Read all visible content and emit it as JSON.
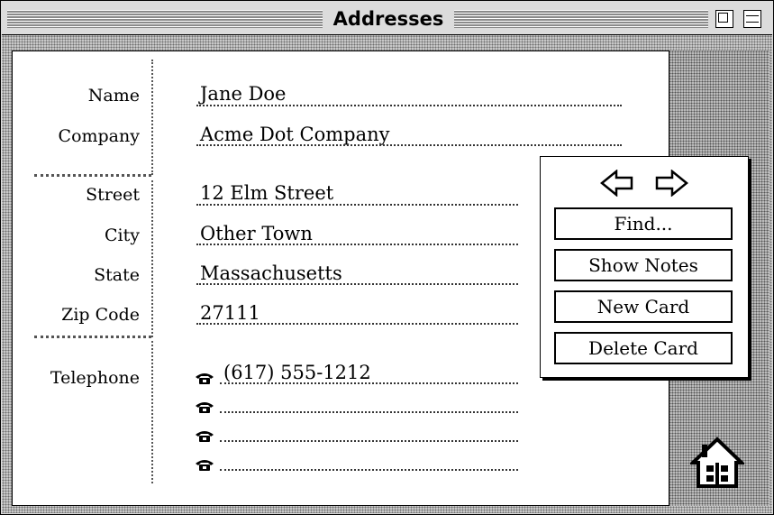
{
  "window": {
    "title": "Addresses"
  },
  "fields": {
    "name": {
      "label": "Name",
      "value": "Jane Doe"
    },
    "company": {
      "label": "Company",
      "value": "Acme Dot Company"
    },
    "street": {
      "label": "Street",
      "value": "12 Elm Street"
    },
    "city": {
      "label": "City",
      "value": "Other Town"
    },
    "state": {
      "label": "State",
      "value": "Massachusetts"
    },
    "zip": {
      "label": "Zip Code",
      "value": "27111"
    },
    "telephone": {
      "label": "Telephone",
      "values": [
        "(617) 555-1212",
        "",
        "",
        ""
      ]
    }
  },
  "palette": {
    "find_label": "Find...",
    "show_notes_label": "Show Notes",
    "new_card_label": "New Card",
    "delete_card_label": "Delete Card"
  },
  "icons": {
    "prev": "left-arrow-icon",
    "next": "right-arrow-icon",
    "phone": "telephone-icon",
    "home": "home-icon",
    "zoom": "zoom-box-icon",
    "collapse": "collapse-box-icon"
  }
}
